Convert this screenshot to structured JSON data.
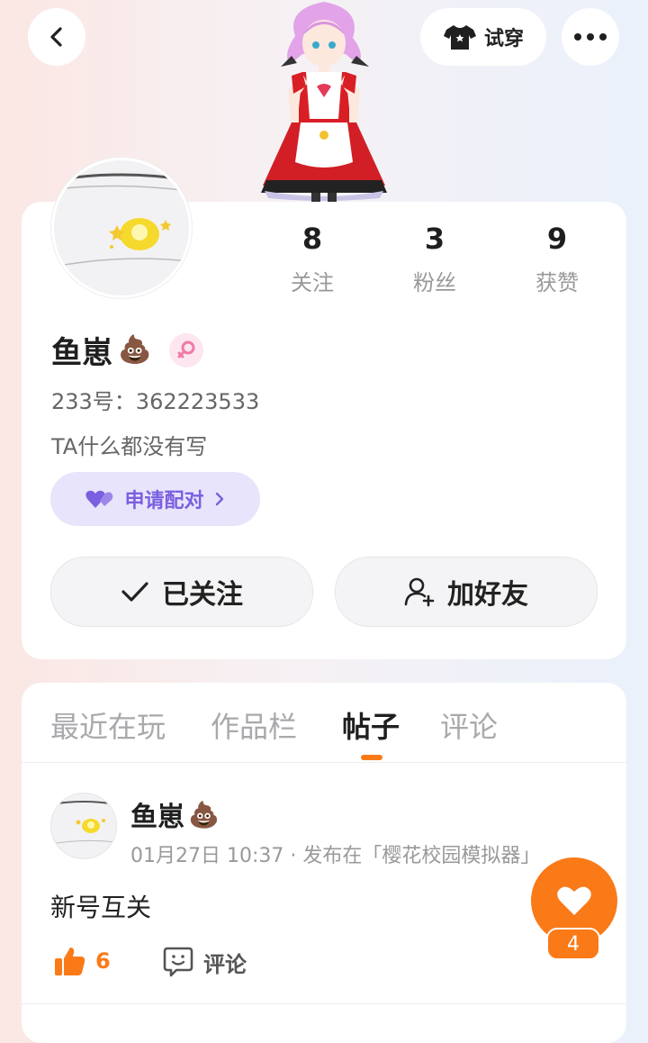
{
  "header": {
    "back_icon": "chevron-left-icon",
    "try_on_label": "试穿",
    "more_icon": "more-dots-icon"
  },
  "profile": {
    "stats": [
      {
        "value": "8",
        "label": "关注"
      },
      {
        "value": "3",
        "label": "粉丝"
      },
      {
        "value": "9",
        "label": "获赞"
      }
    ],
    "name": "鱼崽",
    "name_emoji": "💩",
    "gender": "female",
    "gender_icon": "female-symbol-icon",
    "id_line": "233号：362223533",
    "bio": "TA什么都没有写",
    "pair_label": "申请配对",
    "followed_label": "已关注",
    "add_friend_label": "加好友"
  },
  "tabs": [
    "最近在玩",
    "作品栏",
    "帖子",
    "评论"
  ],
  "active_tab": "帖子",
  "post": {
    "author": "鱼崽",
    "author_emoji": "💩",
    "meta": "01月27日 10:37 · 发布在「樱花校园模拟器」",
    "content": "新号互关",
    "like_count": "6",
    "comment_label": "评论"
  },
  "floating": {
    "heart_count": "4"
  },
  "colors": {
    "accent_orange": "#fa7a18",
    "pair_purple": "#7a5fe0",
    "pair_bg": "#e8e4fb",
    "gender_pink": "#f07aa8"
  }
}
